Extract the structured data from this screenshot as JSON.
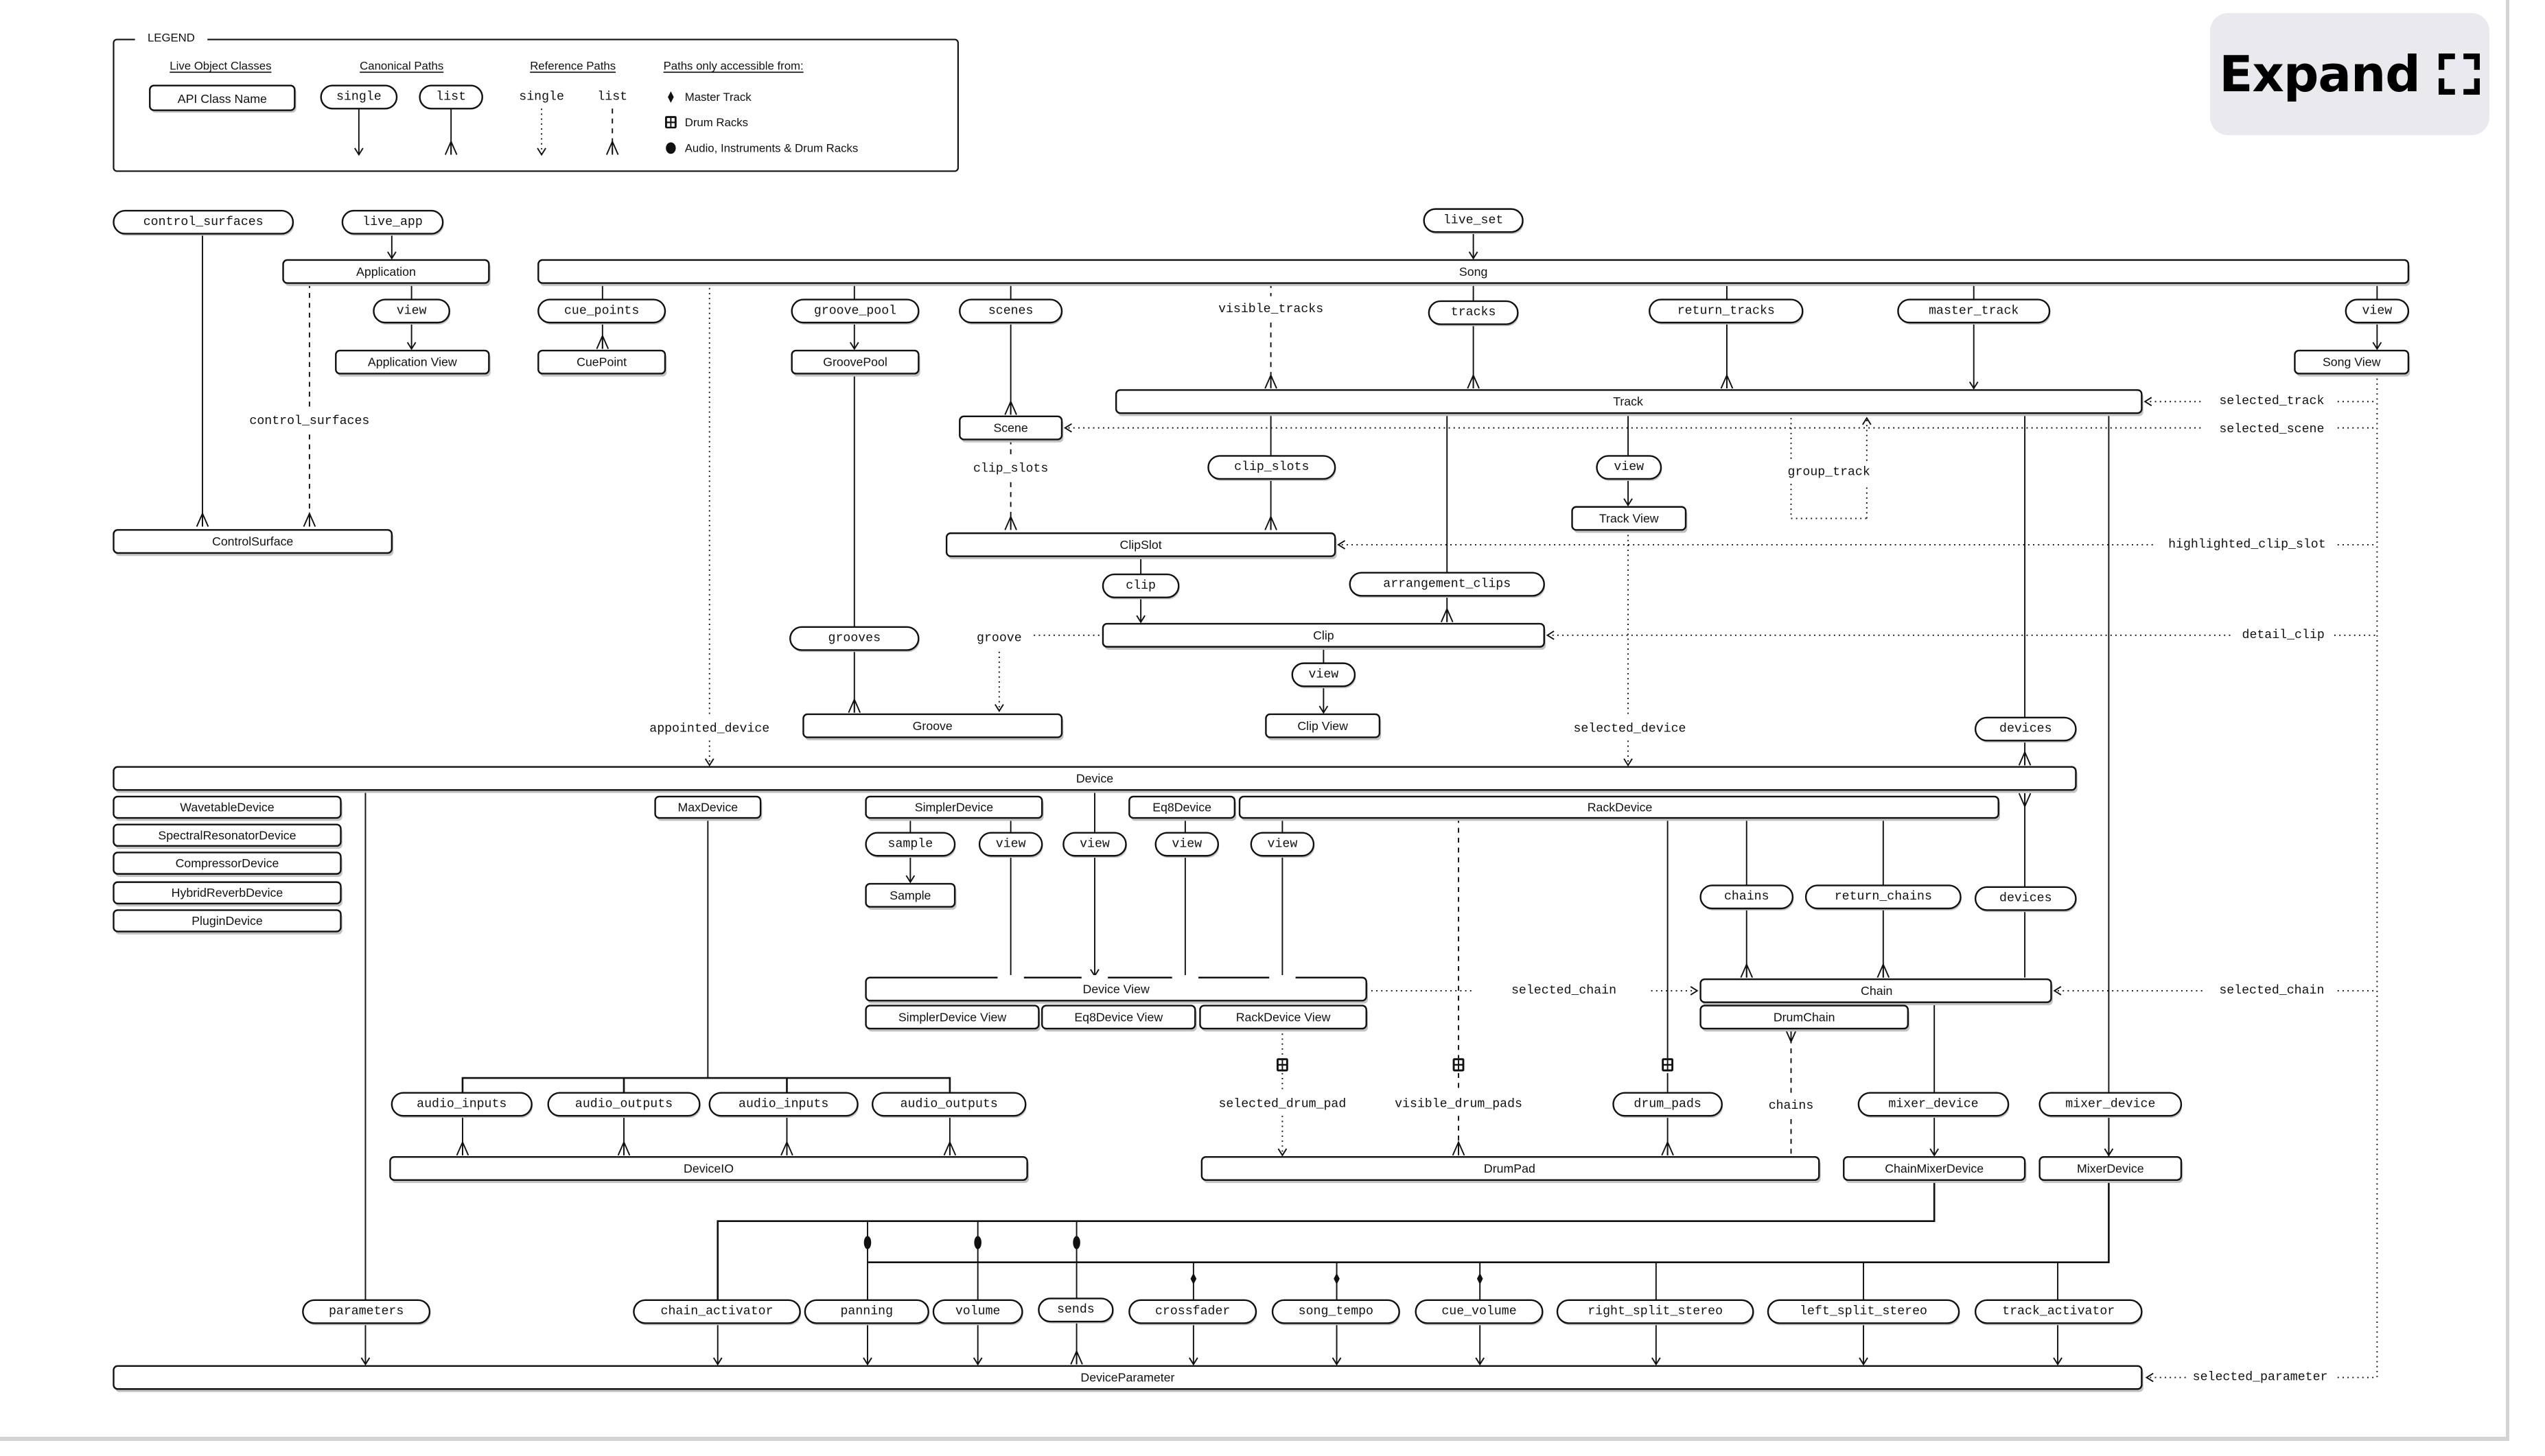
{
  "expand_button": {
    "label": "Expand",
    "icon": "fullscreen-corners-icon"
  },
  "legend": {
    "title": "LEGEND",
    "col_classes": "Live Object Classes",
    "col_canonical": "Canonical Paths",
    "col_reference": "Reference Paths",
    "col_access": "Paths only accessible from:",
    "sample_class": "API Class Name",
    "canonical_single": "single",
    "canonical_list": "list",
    "reference_single": "single",
    "reference_list": "list",
    "access_master": "Master Track",
    "access_drum": "Drum Racks",
    "access_audio": "Audio, Instruments & Drum Racks",
    "access_master_icon": "diamond-icon",
    "access_drum_icon": "drum-rack-grid-icon",
    "access_audio_icon": "filled-circle-icon"
  },
  "classes": {
    "application": "Application",
    "application_view": "Application View",
    "control_surface": "ControlSurface",
    "cue_point": "CuePoint",
    "song": "Song",
    "groove_pool": "GroovePool",
    "song_view": "Song View",
    "track": "Track",
    "scene": "Scene",
    "track_view": "Track View",
    "clip_slot": "ClipSlot",
    "clip": "Clip",
    "groove": "Groove",
    "clip_view": "Clip View",
    "device": "Device",
    "wavetable_device": "WavetableDevice",
    "spectral_resonator_device": "SpectralResonatorDevice",
    "compressor_device": "CompressorDevice",
    "hybrid_reverb_device": "HybridReverbDevice",
    "plugin_device": "PluginDevice",
    "max_device": "MaxDevice",
    "simpler_device": "SimplerDevice",
    "eq8_device": "Eq8Device",
    "rack_device": "RackDevice",
    "sample": "Sample",
    "device_view": "Device View",
    "simpler_device_view": "SimplerDevice View",
    "eq8_device_view": "Eq8Device View",
    "rack_device_view": "RackDevice View",
    "chain": "Chain",
    "drum_chain": "DrumChain",
    "device_io": "DeviceIO",
    "drum_pad": "DrumPad",
    "chain_mixer_device": "ChainMixerDevice",
    "mixer_device": "MixerDevice",
    "device_parameter": "DeviceParameter"
  },
  "properties": {
    "control_surfaces": "control_surfaces",
    "live_app": "live_app",
    "live_set": "live_set",
    "app_view": "view",
    "cue_points": "cue_points",
    "groove_pool": "groove_pool",
    "scenes": "scenes",
    "tracks": "tracks",
    "return_tracks": "return_tracks",
    "master_track": "master_track",
    "song_view": "view",
    "track_clip_slots": "clip_slots",
    "track_view": "view",
    "clip": "clip",
    "arrangement_clips": "arrangement_clips",
    "grooves": "grooves",
    "clip_view": "view",
    "track_devices": "devices",
    "sample": "sample",
    "simpler_view": "view",
    "device_view": "view",
    "eq8_view": "view",
    "rack_view": "view",
    "chains": "chains",
    "return_chains": "return_chains",
    "chain_devices": "devices",
    "audio_inputs_1": "audio_inputs",
    "audio_outputs_1": "audio_outputs",
    "audio_inputs_2": "audio_inputs",
    "audio_outputs_2": "audio_outputs",
    "drum_pads": "drum_pads",
    "chain_mixer_device": "mixer_device",
    "track_mixer_device": "mixer_device",
    "parameters": "parameters",
    "chain_activator": "chain_activator",
    "panning": "panning",
    "volume": "volume",
    "sends": "sends",
    "crossfader": "crossfader",
    "song_tempo": "song_tempo",
    "cue_volume": "cue_volume",
    "right_split_stereo": "right_split_stereo",
    "left_split_stereo": "left_split_stereo",
    "track_activator": "track_activator"
  },
  "references": {
    "control_surfaces": "control_surfaces",
    "appointed_device": "appointed_device",
    "visible_tracks": "visible_tracks",
    "scene_clip_slots": "clip_slots",
    "groove": "groove",
    "selected_device": "selected_device",
    "group_track": "group_track",
    "selected_track": "selected_track",
    "selected_scene": "selected_scene",
    "highlighted_clip_slot": "highlighted_clip_slot",
    "detail_clip": "detail_clip",
    "selected_chain_rack": "selected_chain",
    "selected_chain_song": "selected_chain",
    "selected_drum_pad": "selected_drum_pad",
    "visible_drum_pads": "visible_drum_pads",
    "drum_chain_chains": "chains",
    "selected_parameter": "selected_parameter"
  }
}
